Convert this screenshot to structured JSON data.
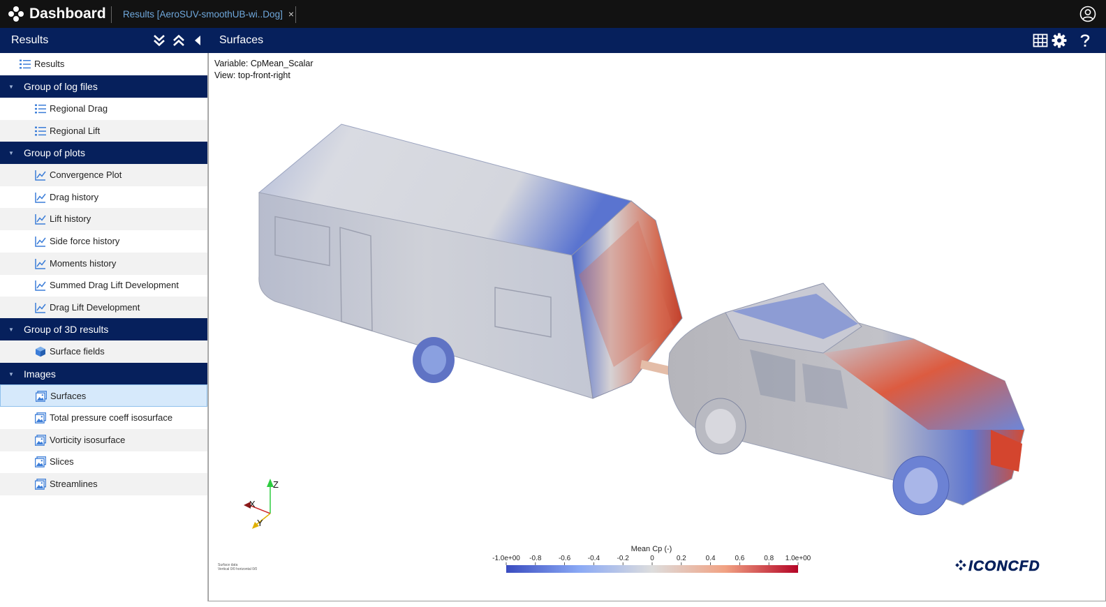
{
  "app": {
    "title": "Dashboard",
    "tab_label": "Results [AeroSUV-smoothUB-wi..Dog]",
    "tab_close": "×"
  },
  "sidebar": {
    "title": "Results",
    "root_item": "Results",
    "groups": [
      {
        "label": "Group of log files",
        "items": [
          "Regional Drag",
          "Regional Lift"
        ]
      },
      {
        "label": "Group of plots",
        "items": [
          "Convergence Plot",
          "Drag history",
          "Lift history",
          "Side force history",
          "Moments history",
          "Summed Drag Lift Development",
          "Drag Lift Development"
        ]
      },
      {
        "label": "Group of 3D results",
        "items": [
          "Surface fields"
        ]
      },
      {
        "label": "Images",
        "items": [
          "Surfaces",
          "Total pressure coeff isosurface",
          "Vorticity isosurface",
          "Slices",
          "Streamlines"
        ]
      }
    ],
    "selected_item": "Surfaces",
    "caret": "▼"
  },
  "main": {
    "title": "Surfaces",
    "variable_line": "Variable: CpMean_Scalar",
    "view_line": "View: top-front-right",
    "footnote_line1": "Surface data",
    "footnote_line2": "Vertical 0/0 horizontal 0/0",
    "brand_logo": "ICONCFD",
    "colorbar": {
      "title": "Mean Cp (-)",
      "ticks": [
        "-1.0e+00",
        "-0.8",
        "-0.6",
        "-0.4",
        "-0.2",
        "0",
        "0.2",
        "0.4",
        "0.6",
        "0.8",
        "1.0e+00"
      ],
      "range": [
        -1.0,
        1.0
      ],
      "colors": {
        "low": "#3a4cc0",
        "mid": "#dddddd",
        "high": "#b40426"
      }
    },
    "axes": {
      "x": "X",
      "y": "Y",
      "z": "Z"
    }
  },
  "colors": {
    "topbar": "#121212",
    "header": "#06205c",
    "tab_text": "#6fa8dc",
    "selected_row": "#d6e9fb",
    "icon_blue": "#3b7dd8"
  },
  "icons": {
    "logo": "dots-logo-icon",
    "user": "user-circle-icon",
    "expand_all": "double-chevron-down-icon",
    "collapse_all": "double-chevron-up-icon",
    "collapse_panel": "triangle-left-icon",
    "grid": "grid-icon",
    "settings": "gear-icon",
    "help": "question-icon",
    "list": "list-icon",
    "chart": "line-chart-icon",
    "cube": "cube-icon",
    "image": "image-icon"
  }
}
